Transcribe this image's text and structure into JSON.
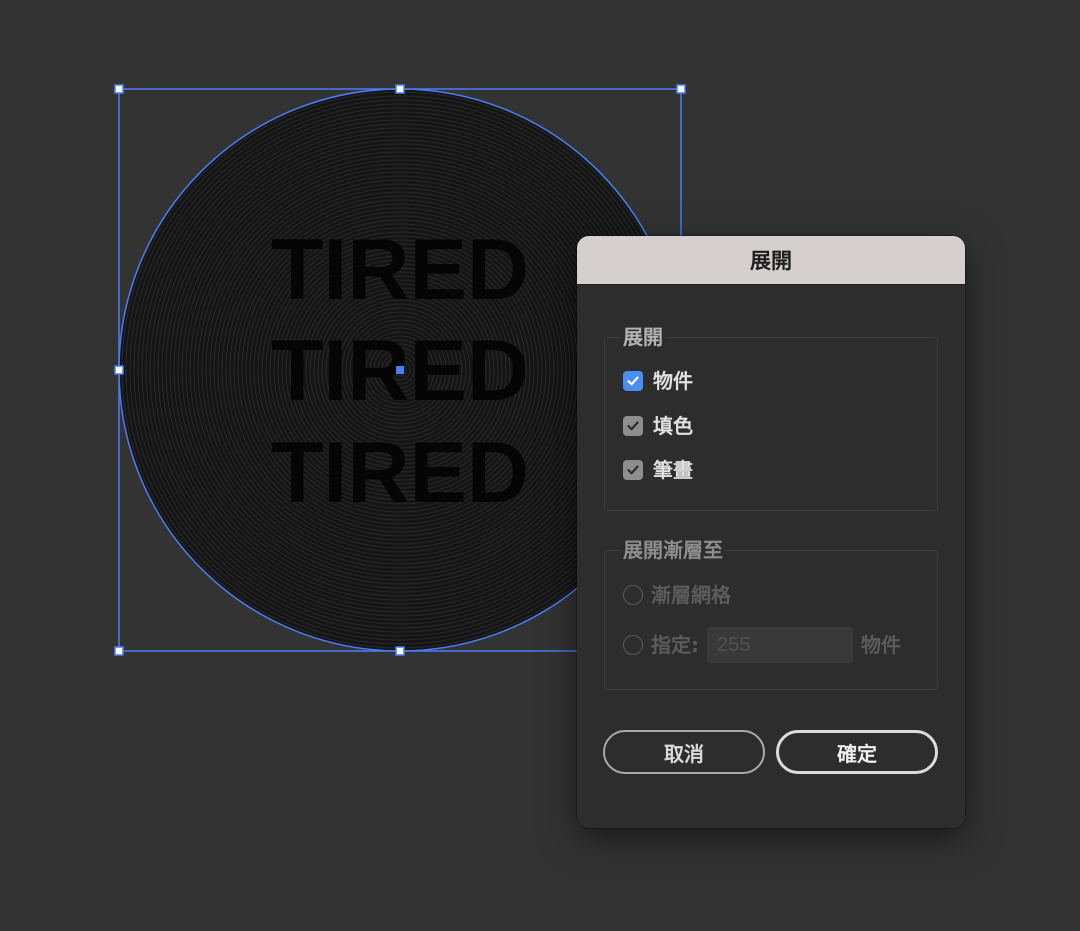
{
  "canvas": {
    "art_lines": [
      "TIRED",
      "TIRED",
      "TIRED"
    ],
    "selection_color": "#4a7cf5",
    "background_color": "#333333"
  },
  "dialog": {
    "title": "展開",
    "expand_group": {
      "title": "展開",
      "options": [
        {
          "label": "物件",
          "checked": true,
          "style": "accent"
        },
        {
          "label": "填色",
          "checked": true,
          "style": "gray"
        },
        {
          "label": "筆畫",
          "checked": true,
          "style": "gray"
        }
      ]
    },
    "gradient_group": {
      "title": "展開漸層至",
      "option_mesh": "漸層網格",
      "option_specify": "指定:",
      "specify_value": "255",
      "specify_unit": "物件"
    },
    "buttons": {
      "cancel": "取消",
      "ok": "確定"
    },
    "colors": {
      "accent": "#4a8ff0",
      "titlebar": "#d5cfcf",
      "panel": "#2d2d2d"
    }
  }
}
